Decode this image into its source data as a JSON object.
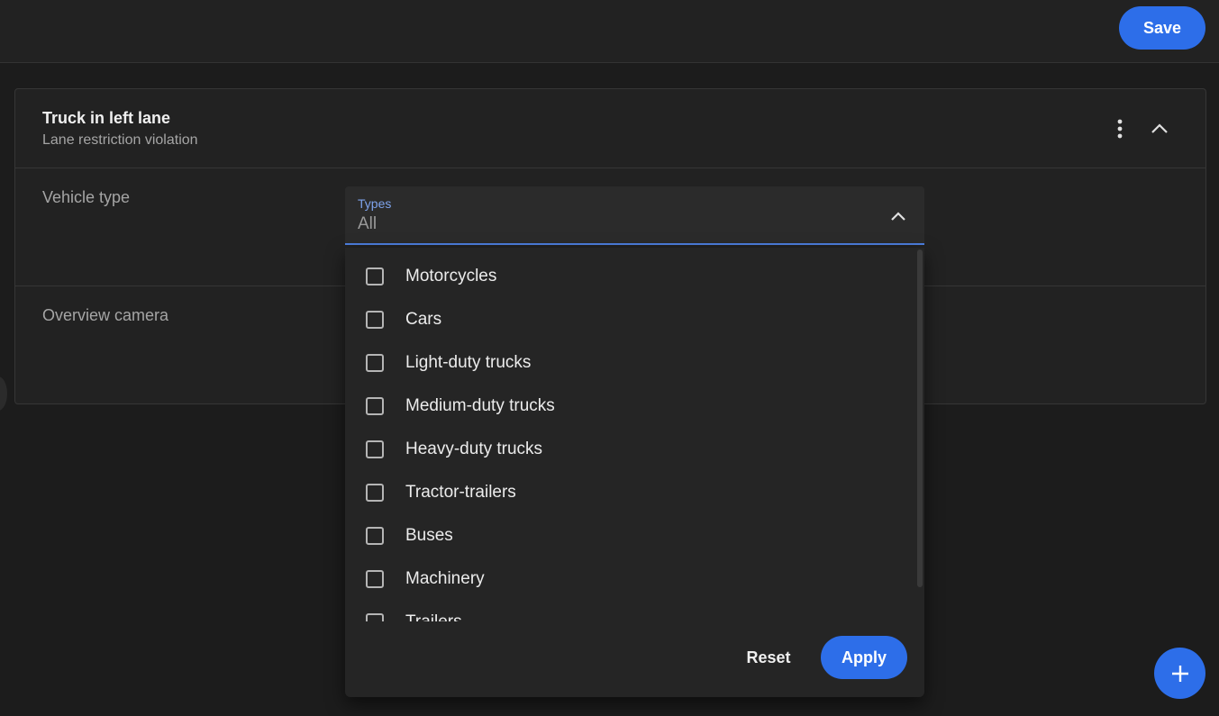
{
  "toolbar": {
    "save_label": "Save"
  },
  "rule": {
    "title": "Truck in left lane",
    "subtitle": "Lane restriction violation",
    "more_icon": "more-vertical-icon",
    "collapse_icon": "chevron-up-icon"
  },
  "fields": {
    "vehicle_type_label": "Vehicle type",
    "overview_camera_label": "Overview camera"
  },
  "select": {
    "label": "Types",
    "value": "All",
    "chevron_icon": "chevron-up-icon"
  },
  "dropdown": {
    "options": [
      {
        "label": "Motorcycles",
        "checked": false
      },
      {
        "label": "Cars",
        "checked": false
      },
      {
        "label": "Light-duty trucks",
        "checked": false
      },
      {
        "label": "Medium-duty trucks",
        "checked": false
      },
      {
        "label": "Heavy-duty trucks",
        "checked": false
      },
      {
        "label": "Tractor-trailers",
        "checked": false
      },
      {
        "label": "Buses",
        "checked": false
      },
      {
        "label": "Machinery",
        "checked": false
      },
      {
        "label": "Trailers",
        "checked": false
      }
    ],
    "reset_label": "Reset",
    "apply_label": "Apply"
  },
  "fab": {
    "icon": "plus-icon"
  },
  "colors": {
    "accent": "#2d6ee9",
    "background": "#1c1c1c",
    "surface": "#222222"
  }
}
